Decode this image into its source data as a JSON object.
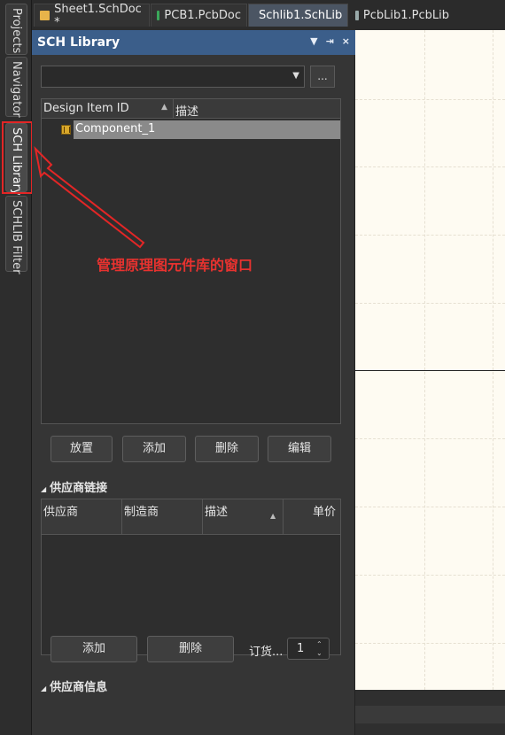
{
  "vertical_tabs": {
    "projects": "Projects",
    "navigator": "Navigator",
    "sch_library": "SCH Library",
    "schlib_filter": "SCHLIB Filter"
  },
  "doc_tabs": [
    {
      "label": "Sheet1.SchDoc *",
      "icon": "schdoc-icon",
      "color": "#e8b44a"
    },
    {
      "label": "PCB1.PcbDoc",
      "icon": "pcbdoc-icon",
      "color": "#3aa85a"
    },
    {
      "label": "Schlib1.SchLib",
      "icon": "schlib-icon",
      "color": "#f0c040"
    },
    {
      "label": "PcbLib1.PcbLib",
      "icon": "pcblib-icon",
      "color": "#9aa"
    }
  ],
  "panel": {
    "title": "SCH Library",
    "controls": [
      "▼",
      "⇥",
      "×"
    ],
    "dots_label": "...",
    "table": {
      "col_id": "Design Item ID",
      "col_desc": "描述",
      "rows": [
        {
          "id": "Component_1",
          "desc": ""
        }
      ]
    },
    "buttons": {
      "place": "放置",
      "add": "添加",
      "delete": "删除",
      "edit": "编辑"
    },
    "supplier_links": {
      "title": "供应商链接",
      "columns": [
        "供应商",
        "制造商",
        "描述",
        "单价"
      ],
      "add": "添加",
      "delete": "删除",
      "order_label": "订货...",
      "order_value": "1"
    },
    "supplier_info": {
      "title": "供应商信息"
    }
  },
  "annotation": {
    "text": "管理原理图元件库的窗口",
    "color": "#e32626"
  }
}
